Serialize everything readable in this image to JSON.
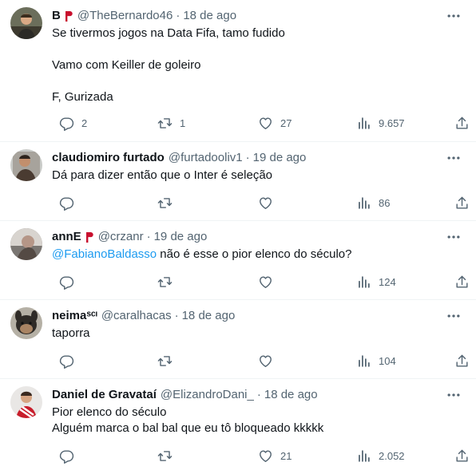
{
  "tweets": [
    {
      "name": "B",
      "flag": true,
      "handle": "@TheBernardo46",
      "dot": "·",
      "time": "18 de ago",
      "lines": [
        "Se tivermos jogos na Data Fifa, tamo fudido",
        "",
        "Vamo com Keiller de goleiro",
        "",
        "F, Gurizada"
      ],
      "replies": "2",
      "retweets": "1",
      "likes": "27",
      "views": "9.657"
    },
    {
      "name": "claudiomiro furtado",
      "flag": false,
      "handle": "@furtadooliv1",
      "dot": "·",
      "time": "19 de ago",
      "lines": [
        "Dá para dizer então que o Inter é seleção"
      ],
      "replies": "",
      "retweets": "",
      "likes": "",
      "views": "86"
    },
    {
      "name": "annE",
      "flag": true,
      "handle": "@crzanr",
      "dot": "·",
      "time": "19 de ago",
      "mention": "@FabianoBaldasso",
      "lines": [
        " não é esse o pior elenco do século?"
      ],
      "replies": "",
      "retweets": "",
      "likes": "",
      "views": "124"
    },
    {
      "name": "neimaˢᶜᶦ",
      "flag": false,
      "handle": "@caralhacas",
      "dot": "·",
      "time": "18 de ago",
      "lines": [
        "taporra"
      ],
      "replies": "",
      "retweets": "",
      "likes": "",
      "views": "104"
    },
    {
      "name": "Daniel de Gravataí",
      "flag": false,
      "handle": "@ElizandroDani_",
      "dot": "·",
      "time": "18 de ago",
      "lines": [
        "Pior elenco do século",
        "Alguém marca o bal bal que eu tô bloqueado kkkkk"
      ],
      "replies": "",
      "retweets": "",
      "likes": "21",
      "views": "2.052"
    }
  ],
  "icons": {
    "more": "more-icon",
    "reply": "reply-icon",
    "retweet": "retweet-icon",
    "like": "like-icon",
    "views": "views-icon",
    "share": "share-icon"
  },
  "colors": {
    "text": "#0f1419",
    "secondary": "#536471",
    "link": "#1d9bf0",
    "divider": "#eff3f4",
    "flag": "#c8102e"
  }
}
